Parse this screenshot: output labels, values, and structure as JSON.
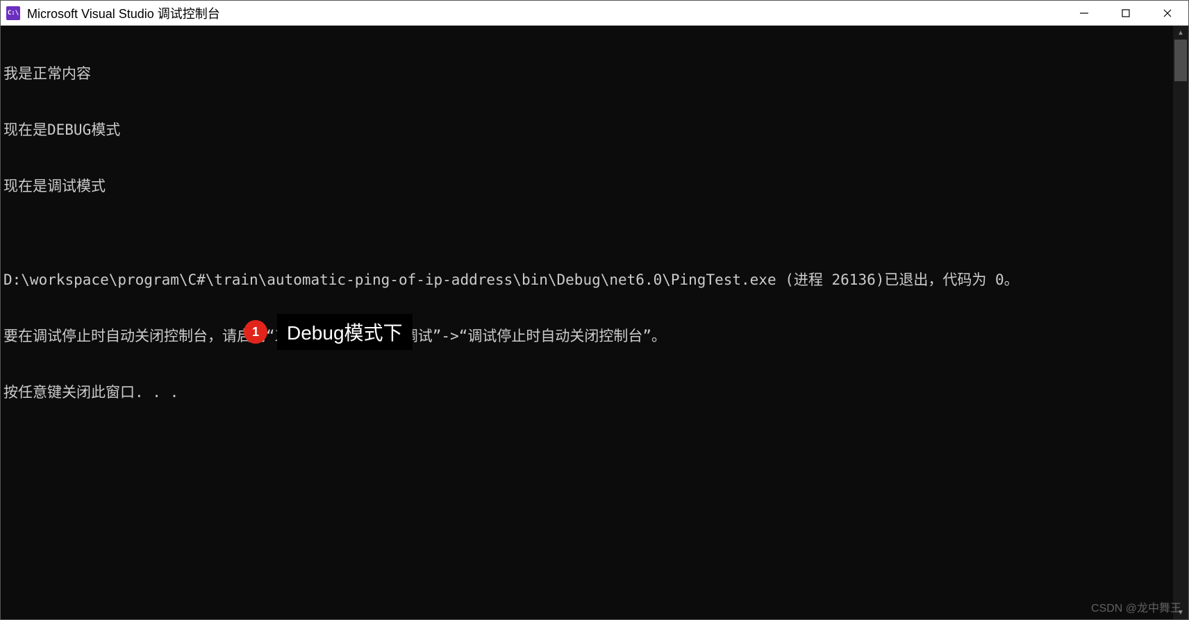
{
  "window": {
    "icon_text": "C:\\",
    "title": "Microsoft Visual Studio 调试控制台"
  },
  "console": {
    "lines": [
      "我是正常内容",
      "现在是DEBUG模式",
      "现在是调试模式",
      "",
      "D:\\workspace\\program\\C#\\train\\automatic-ping-of-ip-address\\bin\\Debug\\net6.0\\PingTest.exe (进程 26136)已退出，代码为 0。",
      "要在调试停止时自动关闭控制台，请启用“工具”->“选项”->“调试”->“调试停止时自动关闭控制台”。",
      "按任意键关闭此窗口. . ."
    ]
  },
  "annotation": {
    "number": "1",
    "label": "Debug模式下"
  },
  "watermark": "CSDN @龙中舞王"
}
